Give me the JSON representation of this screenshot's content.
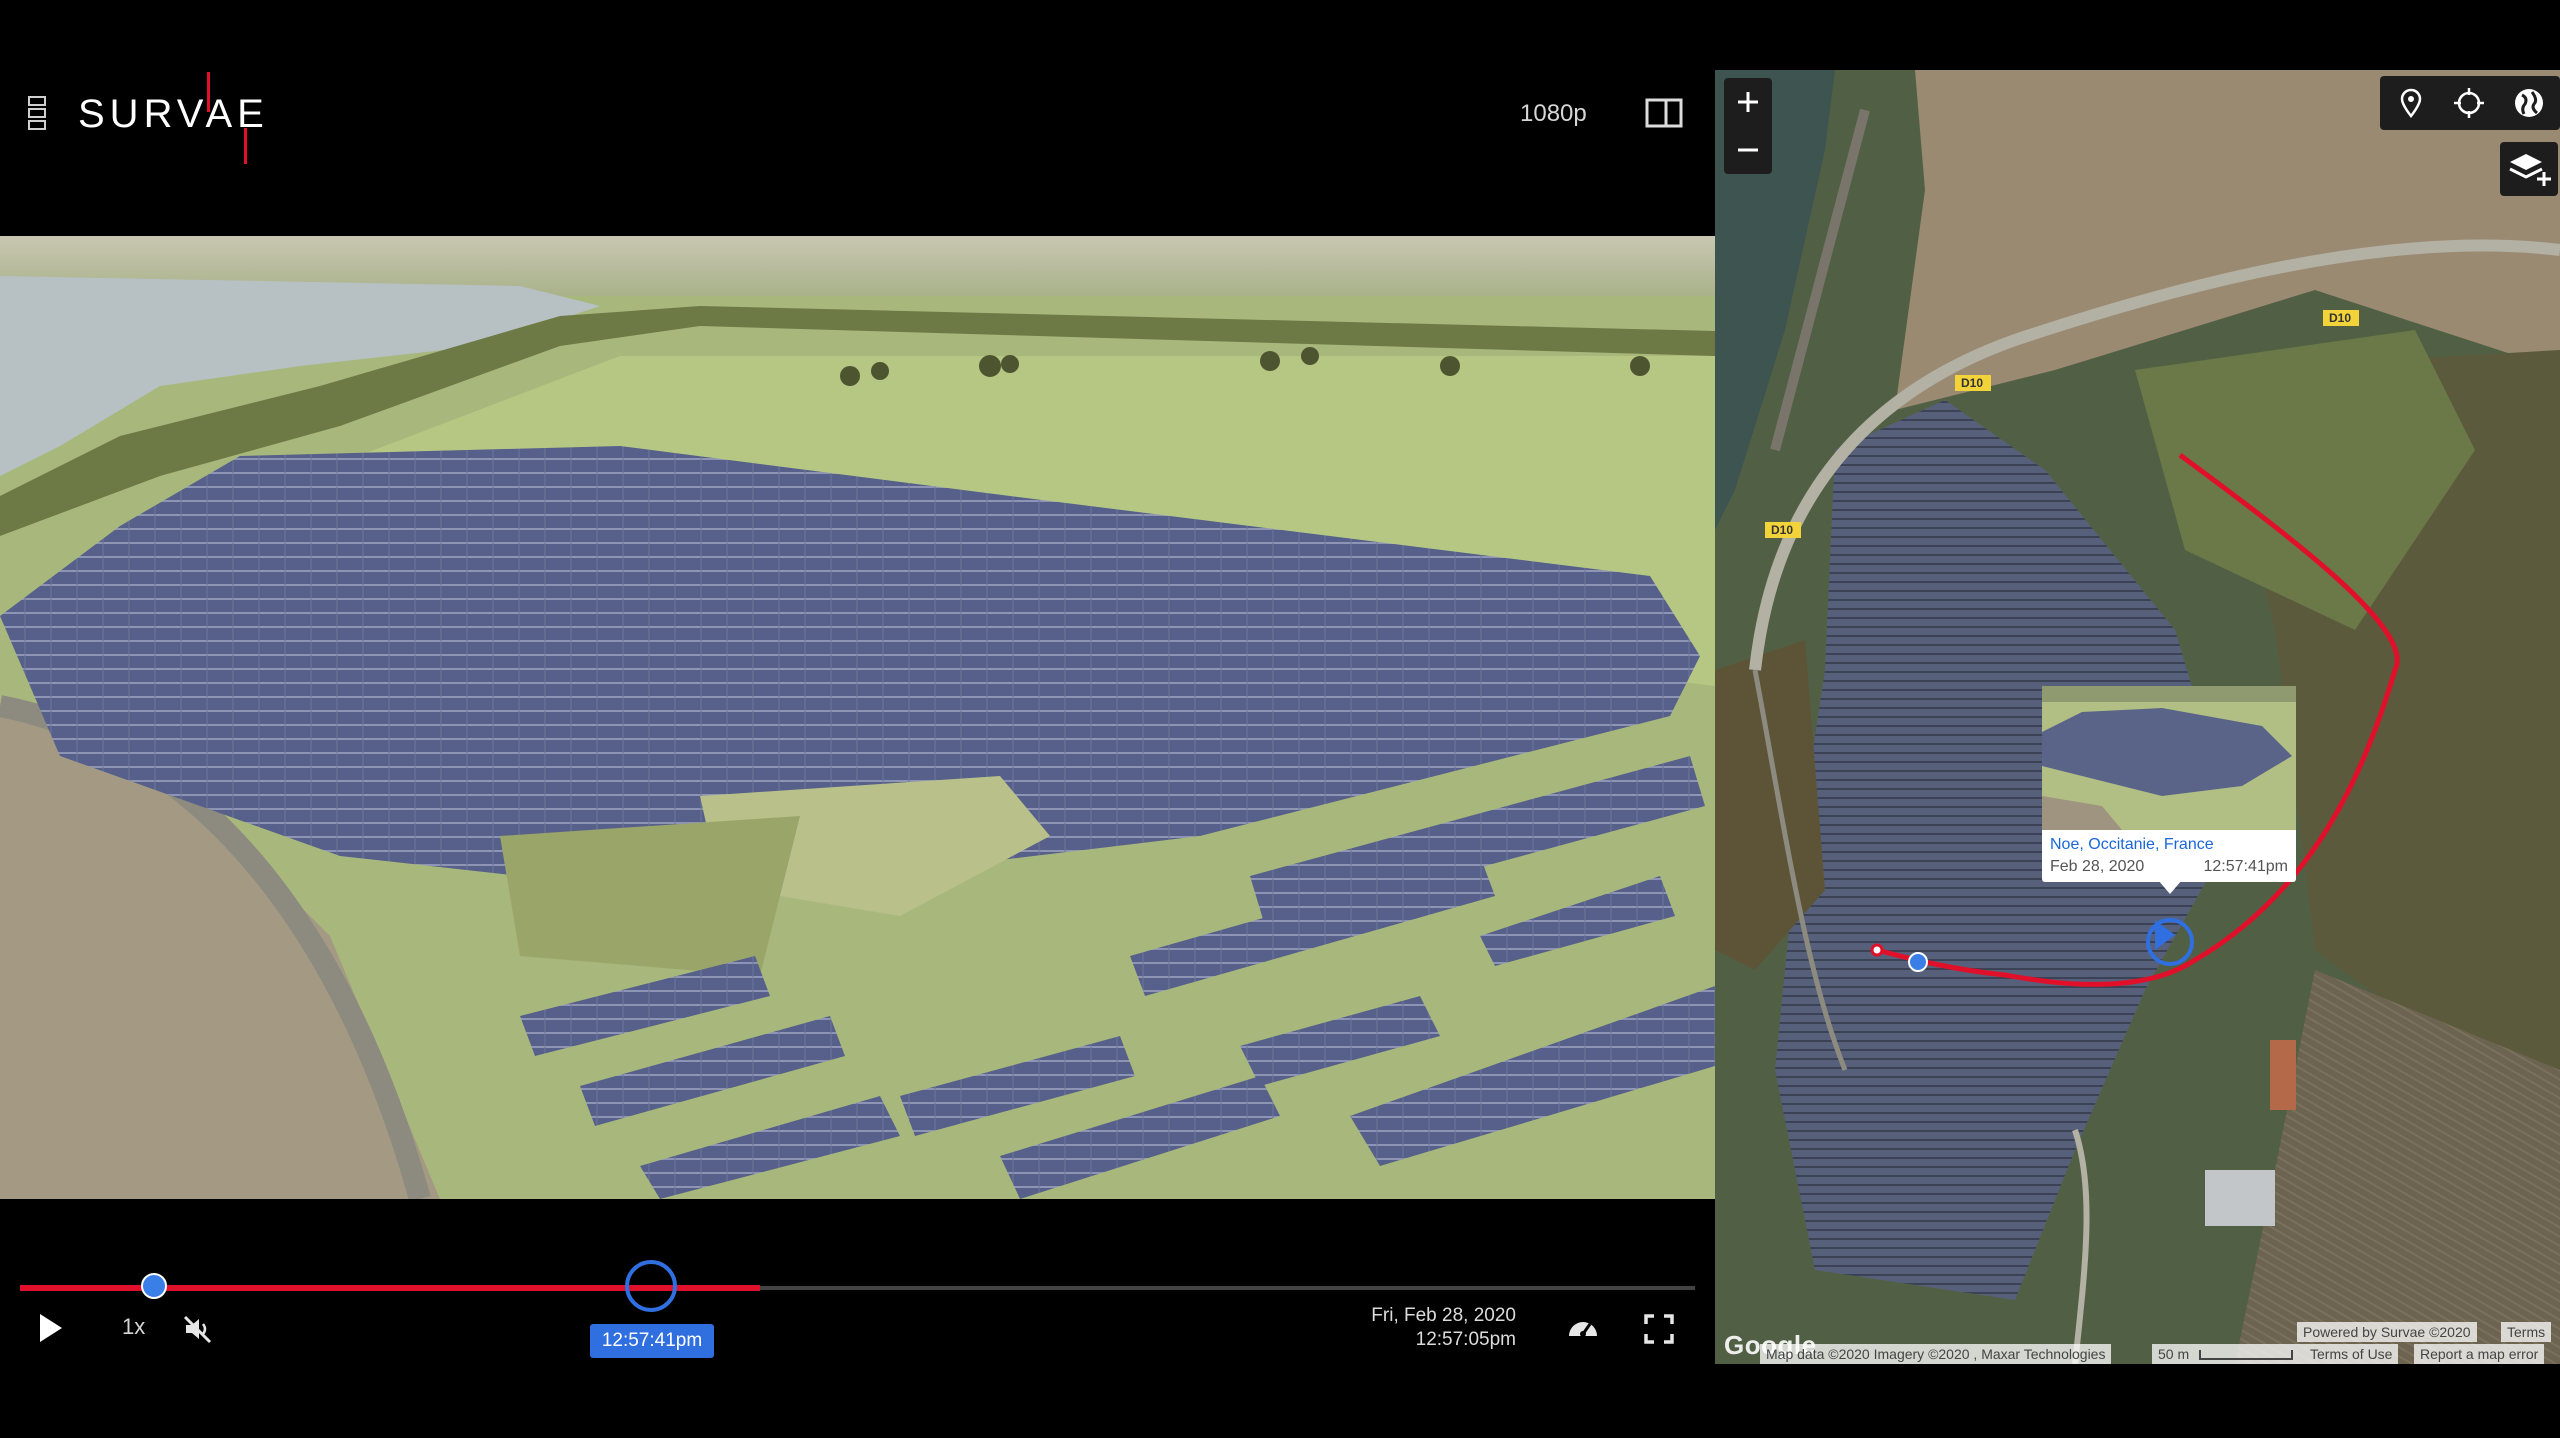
{
  "header": {
    "brand": "SURVAE",
    "quality": "1080p",
    "menu_icon": "menu-icon",
    "layout_icon": "split-view-icon"
  },
  "player": {
    "speed": "1x",
    "hover_time": "12:57:41pm",
    "date": "Fri, Feb 28, 2020",
    "current_time": "12:57:05pm",
    "progress_fraction": 0.08,
    "buffered_fraction": 0.44,
    "hover_fraction": 0.36,
    "accent": "#e0102a",
    "highlight": "#2f6fe0"
  },
  "map": {
    "road_labels": [
      "D10",
      "D10",
      "D10",
      "D10"
    ],
    "popup": {
      "place": "Noe, Occitanie, France",
      "date": "Feb 28, 2020",
      "time": "12:57:41pm"
    },
    "google": "Google",
    "attribution": {
      "powered": "Powered by Survae ©2020",
      "terms": "Terms",
      "map_data": "Map data ©2020 Imagery ©2020 , Maxar Technologies",
      "scale": "50 m",
      "terms_of_use": "Terms of Use",
      "report": "Report a map error"
    },
    "track_color": "#e0102a"
  }
}
